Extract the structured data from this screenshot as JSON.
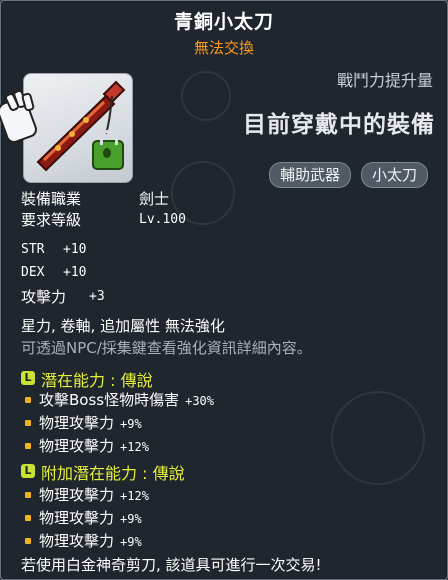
{
  "item": {
    "name": "青銅小太刀",
    "trade_status": "無法交換",
    "combat_power_label": "戰鬥力提升量",
    "equipped_label": "目前穿戴中的裝備",
    "tags": [
      "輔助武器",
      "小太刀"
    ]
  },
  "requirements": {
    "job_label": "裝備職業",
    "job_value": "劍士",
    "level_label": "要求等級",
    "level_value": "Lv.100"
  },
  "stats": [
    {
      "name": "STR",
      "value": "+10"
    },
    {
      "name": "DEX",
      "value": "+10"
    },
    {
      "name": "攻擊力",
      "value": "+3"
    }
  ],
  "enhance_line": "星力, 卷軸, 追加屬性 無法強化",
  "enhance_note": "可透過NPC/採集鍵查看強化資訊詳細內容。",
  "potential": {
    "badge": "L",
    "title": "潛在能力 : 傳說",
    "lines": [
      {
        "text": "攻擊Boss怪物時傷害",
        "value": "+30%"
      },
      {
        "text": "物理攻擊力",
        "value": "+9%"
      },
      {
        "text": "物理攻擊力",
        "value": "+12%"
      }
    ]
  },
  "additional_potential": {
    "badge": "L",
    "title": "附加潛在能力 : 傳說",
    "lines": [
      {
        "text": "物理攻擊力",
        "value": "+12%"
      },
      {
        "text": "物理攻擊力",
        "value": "+9%"
      },
      {
        "text": "物理攻擊力",
        "value": "+9%"
      }
    ]
  },
  "footer": "若使用白金神奇剪刀, 該道具可進行一次交易!",
  "colors": {
    "title": "#ffffff",
    "trade_status": "#ff9a1f",
    "potential_title": "#e7f03a",
    "badge": "#c9e335",
    "bullet": "#f0b41e"
  },
  "icons": {
    "item": "short-sword-icon",
    "lock": "lock-icon",
    "cursor": "glove-cursor-icon"
  }
}
